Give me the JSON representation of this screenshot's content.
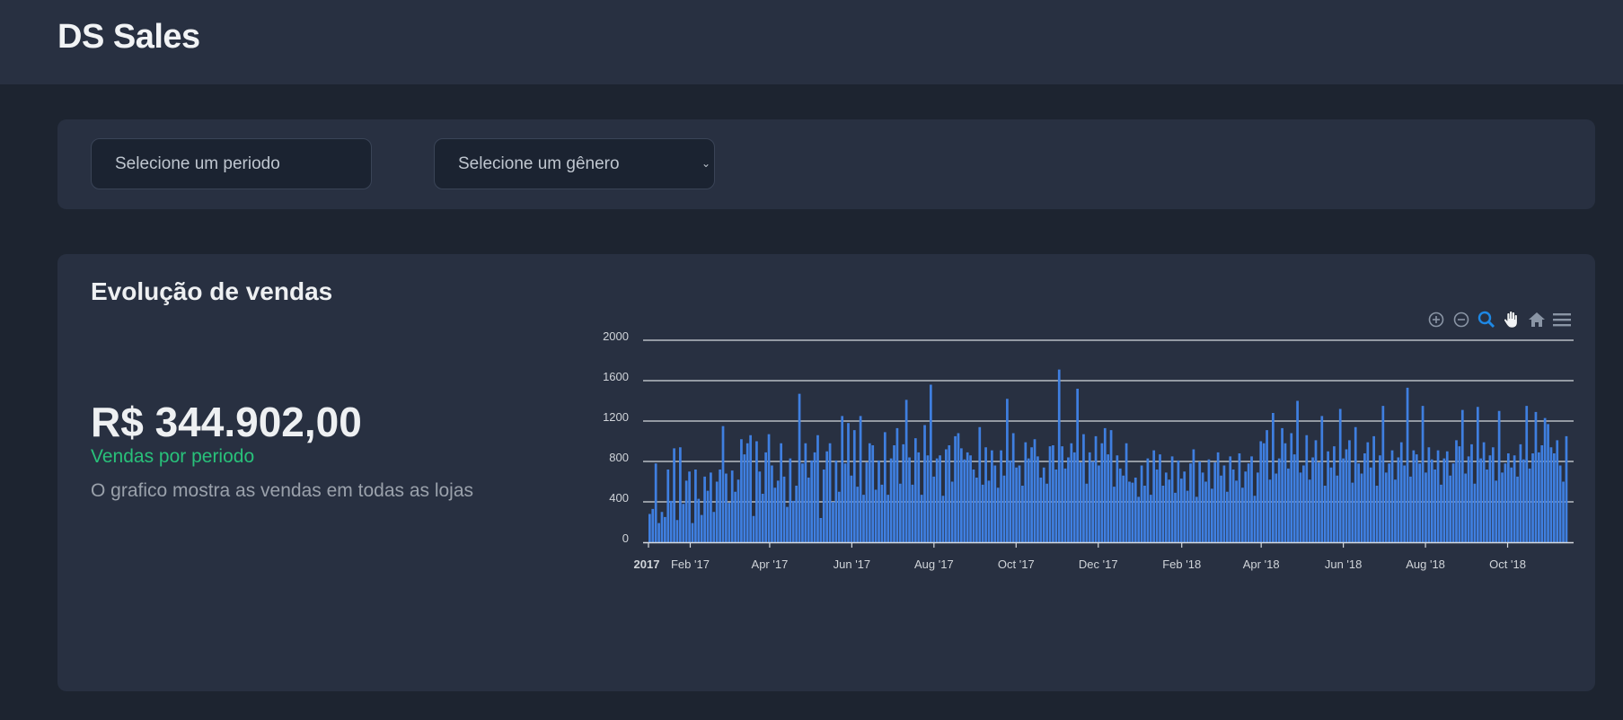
{
  "app": {
    "title": "DS Sales"
  },
  "filters": {
    "period_placeholder": "Selecione um periodo",
    "genre_placeholder": "Selecione um gênero"
  },
  "sales": {
    "title": "Evolução de vendas",
    "total": "R$ 344.902,00",
    "subtitle": "Vendas por periodo",
    "description": "O grafico mostra as vendas em todas as lojas"
  },
  "toolbar": {
    "icons": [
      "zoom-in-icon",
      "zoom-out-icon",
      "selection-zoom-icon",
      "pan-icon",
      "home-icon",
      "menu-icon"
    ]
  },
  "colors": {
    "bar": "#3f7fe0",
    "accent_green": "#28c17a",
    "active_tool": "#1e88e5"
  },
  "chart_data": {
    "type": "bar",
    "title": "",
    "xlabel": "",
    "ylabel": "",
    "ylim": [
      0,
      2000
    ],
    "y_ticks": [
      "0",
      "400",
      "800",
      "1200",
      "1600",
      "2000"
    ],
    "x_tick_labels": [
      "2017",
      "Feb '17",
      "Apr '17",
      "Jun '17",
      "Aug '17",
      "Oct '17",
      "Dec '17",
      "Feb '18",
      "Apr '18",
      "Jun '18",
      "Aug '18",
      "Oct '18"
    ],
    "x_range": [
      "2017-01-01",
      "2018-11-15"
    ],
    "grid": true,
    "series": [
      {
        "values": [
          280,
          330,
          780,
          190,
          300,
          250,
          720,
          410,
          930,
          220,
          940,
          380,
          610,
          700,
          190,
          720,
          430,
          270,
          650,
          510,
          690,
          300,
          600,
          720,
          1150,
          680,
          390,
          710,
          500,
          620,
          1020,
          870,
          980,
          1060,
          260,
          1000,
          700,
          480,
          890,
          1070,
          760,
          540,
          610,
          980,
          650,
          350,
          830,
          410,
          560,
          1470,
          780,
          980,
          640,
          810,
          890,
          1060,
          240,
          720,
          900,
          980,
          400,
          810,
          500,
          1250,
          780,
          1180,
          660,
          1110,
          550,
          1250,
          470,
          790,
          980,
          960,
          520,
          810,
          570,
          1090,
          470,
          830,
          960,
          1130,
          580,
          970,
          1410,
          840,
          570,
          1030,
          890,
          470,
          1160,
          860,
          1560,
          650,
          830,
          860,
          460,
          920,
          960,
          600,
          1050,
          1080,
          930,
          820,
          890,
          860,
          720,
          640,
          1140,
          570,
          940,
          610,
          910,
          760,
          540,
          910,
          660,
          1420,
          810,
          1080,
          740,
          760,
          560,
          990,
          830,
          940,
          1020,
          850,
          640,
          740,
          580,
          950,
          960,
          720,
          1710,
          950,
          730,
          840,
          980,
          890,
          1520,
          790,
          1070,
          580,
          890,
          800,
          1050,
          760,
          980,
          1130,
          870,
          1110,
          550,
          860,
          730,
          660,
          980,
          600,
          590,
          640,
          450,
          760,
          560,
          830,
          470,
          910,
          720,
          870,
          560,
          690,
          620,
          850,
          490,
          810,
          630,
          700,
          510,
          780,
          920,
          450,
          800,
          690,
          600,
          820,
          530,
          790,
          890,
          660,
          760,
          500,
          850,
          720,
          610,
          880,
          540,
          700,
          780,
          850,
          460,
          690,
          1000,
          980,
          1110,
          620,
          1280,
          680,
          830,
          1130,
          980,
          730,
          1080,
          870,
          1400,
          690,
          760,
          1060,
          620,
          840,
          1010,
          790,
          1250,
          560,
          900,
          740,
          950,
          660,
          1320,
          830,
          920,
          1010,
          590,
          1140,
          780,
          680,
          880,
          990,
          740,
          1050,
          560,
          860,
          1350,
          690,
          780,
          910,
          620,
          840,
          990,
          760,
          1530,
          650,
          910,
          870,
          780,
          1350,
          690,
          940,
          820,
          720,
          910,
          570,
          830,
          900,
          660,
          780,
          1010,
          950,
          1310,
          680,
          850,
          970,
          580,
          1340,
          830,
          990,
          720,
          860,
          940,
          610,
          1300,
          690,
          780,
          880,
          740,
          860,
          650,
          970,
          820,
          1350,
          730,
          880,
          1290,
          890,
          960,
          1230,
          1170,
          940,
          880,
          1010,
          760,
          600,
          1050
        ]
      }
    ]
  }
}
